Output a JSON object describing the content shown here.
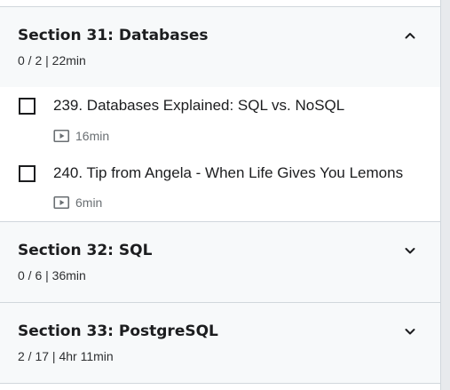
{
  "sections": [
    {
      "title": "Section 31: Databases",
      "meta": "0 / 2 | 22min",
      "expanded": true,
      "chevron_icon": "chevron-up-icon",
      "lectures": [
        {
          "title": "239. Databases Explained: SQL vs. NoSQL",
          "duration": "16min",
          "type_icon": "video-icon",
          "completed": false
        },
        {
          "title": "240. Tip from Angela - When Life Gives You Lemons",
          "duration": "6min",
          "type_icon": "video-icon",
          "completed": false
        }
      ]
    },
    {
      "title": "Section 32: SQL",
      "meta": "0 / 6 | 36min",
      "expanded": false,
      "chevron_icon": "chevron-down-icon"
    },
    {
      "title": "Section 33: PostgreSQL",
      "meta": "2 / 17 | 4hr 11min",
      "expanded": false,
      "chevron_icon": "chevron-down-icon"
    }
  ],
  "colors": {
    "section_background": "#f7f9fa",
    "lecture_background": "#ffffff",
    "border": "#d1d7dc",
    "text_primary": "#1c1d1f",
    "text_secondary": "#6a6f73"
  }
}
